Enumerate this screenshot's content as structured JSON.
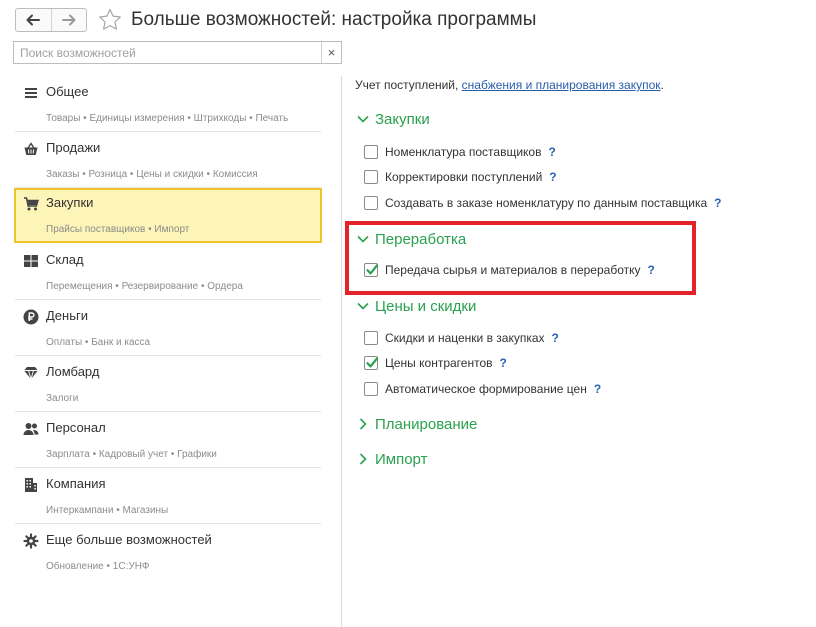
{
  "header": {
    "back_icon": "arrow-left-icon",
    "forward_icon": "arrow-right-icon",
    "favorite_icon": "star-icon",
    "title": "Больше возможностей: настройка программы"
  },
  "search": {
    "placeholder": "Поиск возможностей",
    "value": "",
    "clear_label": "×"
  },
  "sidebar": {
    "items": [
      {
        "title": "Общее",
        "subtitle": "Товары • Единицы измерения • Штрихкоды • Печать",
        "icon": "list-icon",
        "active": false
      },
      {
        "title": "Продажи",
        "subtitle": "Заказы • Розница • Цены и скидки • Комиссия",
        "icon": "basket-icon",
        "active": false
      },
      {
        "title": "Закупки",
        "subtitle": "Прайсы поставщиков • Импорт",
        "icon": "cart-icon",
        "active": true
      },
      {
        "title": "Склад",
        "subtitle": "Перемещения • Резервирование • Ордера",
        "icon": "warehouse-icon",
        "active": false
      },
      {
        "title": "Деньги",
        "subtitle": "Оплаты • Банк и касса",
        "icon": "ruble-icon",
        "active": false
      },
      {
        "title": "Ломбард",
        "subtitle": "Залоги",
        "icon": "diamond-icon",
        "active": false
      },
      {
        "title": "Персонал",
        "subtitle": "Зарплата • Кадровый учет • Графики",
        "icon": "people-icon",
        "active": false
      },
      {
        "title": "Компания",
        "subtitle": "Интеркампани • Магазины",
        "icon": "company-icon",
        "active": false
      },
      {
        "title": "Еще больше возможностей",
        "subtitle": "Обновление • 1С:УНФ",
        "icon": "gear-icon",
        "active": false
      }
    ]
  },
  "main": {
    "intro_text": "Учет поступлений, ",
    "intro_link": "снабжения и планирования закупок",
    "intro_suffix": ".",
    "help_label": "?",
    "sections": {
      "purchases": {
        "title": "Закупки",
        "expanded": true,
        "options": [
          {
            "label": "Номенклатура поставщиков",
            "checked": false
          },
          {
            "label": "Корректировки поступлений",
            "checked": false
          },
          {
            "label": "Создавать в заказе номенклатуру по данным поставщика",
            "checked": false
          }
        ]
      },
      "processing": {
        "title": "Переработка",
        "expanded": true,
        "options": [
          {
            "label": "Передача сырья и материалов в переработку",
            "checked": true
          }
        ]
      },
      "prices": {
        "title": "Цены и скидки",
        "expanded": true,
        "options": [
          {
            "label": "Скидки и наценки в закупках",
            "checked": false
          },
          {
            "label": "Цены контрагентов",
            "checked": true
          },
          {
            "label": "Автоматическое формирование цен",
            "checked": false
          }
        ]
      },
      "planning": {
        "title": "Планирование",
        "expanded": false
      },
      "import": {
        "title": "Импорт",
        "expanded": false
      }
    }
  },
  "colors": {
    "section_title": "#2aa14f",
    "link": "#2a5da8",
    "help": "#2a62b5",
    "active_bg": "#fdf4b7",
    "active_border": "#f2c42c",
    "highlight_border": "#e3222a"
  }
}
